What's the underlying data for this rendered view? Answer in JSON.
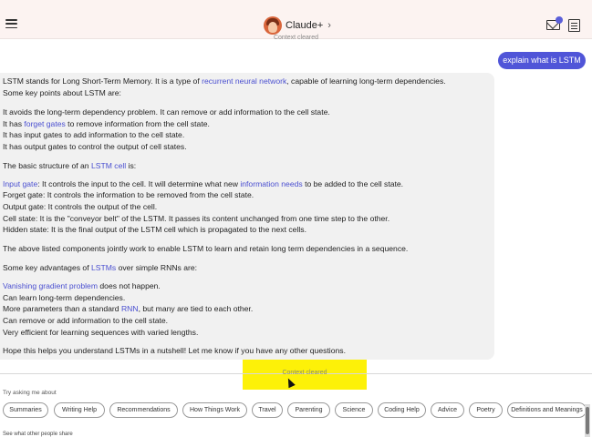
{
  "header": {
    "app_title": "Claude+",
    "chevron": "›",
    "menu_icon": "hamburger-menu-icon",
    "mail_icon": "mail-icon",
    "notes_icon": "notes-icon"
  },
  "context_cleared_top": "Context cleared",
  "user_message": "explain what is LSTM",
  "reply": {
    "lines": [
      {
        "segments": [
          {
            "t": "LSTM stands for Long Short-Term Memory. It is a type of "
          },
          {
            "t": "recurrent neural network",
            "link": true
          },
          {
            "t": ", capable of learning long-term dependencies."
          }
        ]
      },
      {
        "segments": [
          {
            "t": "Some key points about LSTM are:"
          }
        ]
      },
      {
        "segments": [
          {
            "t": "It avoids the long-term dependency problem. It can remove or add information to the cell state."
          }
        ]
      },
      {
        "segments": [
          {
            "t": "It has "
          },
          {
            "t": "forget gates",
            "link": true
          },
          {
            "t": " to remove information from the cell state."
          }
        ]
      },
      {
        "segments": [
          {
            "t": "It has input gates to add information to the cell state."
          }
        ]
      },
      {
        "segments": [
          {
            "t": "It has output gates to control the output of cell states."
          }
        ]
      },
      {
        "segments": [
          {
            "t": "The basic structure of an "
          },
          {
            "t": "LSTM cell",
            "link": true
          },
          {
            "t": " is:"
          }
        ]
      },
      {
        "segments": [
          {
            "t": "Input gate",
            "link": true
          },
          {
            "t": ": It controls the input to the cell. It will determine what new "
          },
          {
            "t": "information needs",
            "link": true
          },
          {
            "t": " to be added to the cell state."
          }
        ]
      },
      {
        "segments": [
          {
            "t": "Forget gate: It controls the information to be removed from the cell state."
          }
        ]
      },
      {
        "segments": [
          {
            "t": "Output gate: It controls the output of the cell."
          }
        ]
      },
      {
        "segments": [
          {
            "t": "Cell state: It is the \"conveyor belt\" of the LSTM. It passes its content unchanged from one time step to the other."
          }
        ]
      },
      {
        "segments": [
          {
            "t": "Hidden state: It is the final output of the LSTM cell which is propagated to the next cells."
          }
        ]
      },
      {
        "segments": [
          {
            "t": "The above listed components jointly work to enable LSTM to learn and retain long term dependencies in a sequence."
          }
        ]
      },
      {
        "segments": [
          {
            "t": "Some key advantages of "
          },
          {
            "t": "LSTMs",
            "link": true
          },
          {
            "t": " over simple RNNs are:"
          }
        ]
      },
      {
        "segments": [
          {
            "t": "Vanishing gradient problem",
            "link": true
          },
          {
            "t": " does not happen."
          }
        ]
      },
      {
        "segments": [
          {
            "t": "Can learn long-term dependencies."
          }
        ]
      },
      {
        "segments": [
          {
            "t": "More parameters than a standard "
          },
          {
            "t": "RNN",
            "link": true
          },
          {
            "t": ", but many are tied to each other."
          }
        ]
      },
      {
        "segments": [
          {
            "t": "Can remove or add information to the cell state."
          }
        ]
      },
      {
        "segments": [
          {
            "t": "Very efficient for learning sequences with varied lengths."
          }
        ]
      },
      {
        "segments": [
          {
            "t": "Hope this helps you understand LSTMs in a nutshell! Let me know if you have any other questions."
          }
        ]
      }
    ]
  },
  "context_cleared": "Context cleared",
  "suggestions": {
    "heading": "Try asking me about",
    "chips": [
      "Summaries",
      "Writing Help",
      "Recommendations",
      "How Things Work",
      "Travel",
      "Parenting",
      "Science",
      "Coding Help",
      "Advice",
      "Poetry",
      "Definitions and Meanings"
    ]
  },
  "see_more": "See what other people share",
  "colors": {
    "accent": "#5055d8",
    "link": "#4a4fd0",
    "highlight": "#fdf108",
    "header_bg": "#fcf3f1"
  }
}
